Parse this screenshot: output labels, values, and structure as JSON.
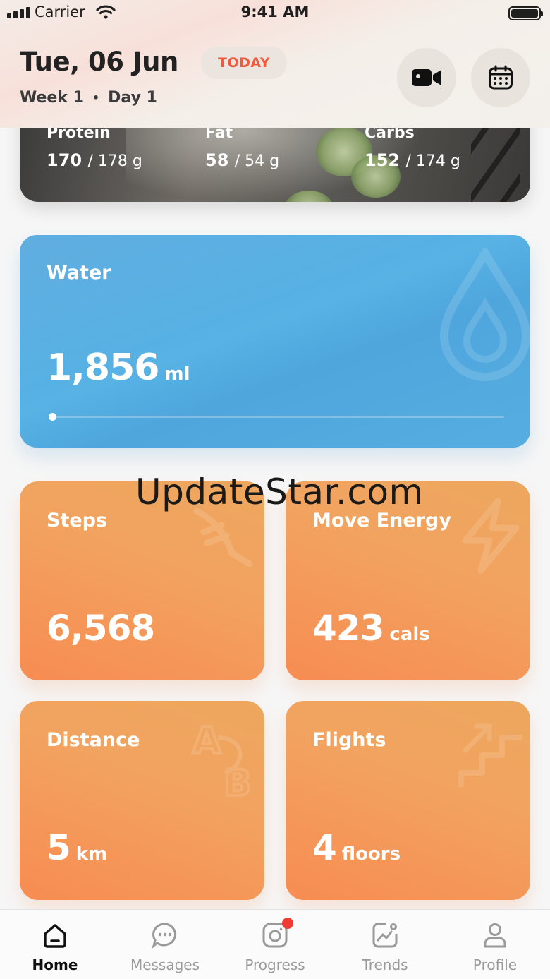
{
  "status_bar": {
    "carrier": "Carrier",
    "time": "9:41 AM"
  },
  "header": {
    "date": "Tue, 06 Jun",
    "today_badge": "TODAY",
    "week": "Week 1",
    "separator": "•",
    "day": "Day 1",
    "video_icon": "video-camera-icon",
    "calendar_icon": "calendar-icon"
  },
  "macros": [
    {
      "label": "Protein",
      "value": "170",
      "target": "/ 178 g"
    },
    {
      "label": "Fat",
      "value": "58",
      "target": "/ 54 g"
    },
    {
      "label": "Carbs",
      "value": "152",
      "target": "/ 174 g"
    }
  ],
  "water": {
    "title": "Water",
    "value": "1,856",
    "unit": "ml",
    "progress": 0.0,
    "icon": "water-drop-icon"
  },
  "tiles": {
    "steps": {
      "title": "Steps",
      "value": "6,568",
      "unit": "",
      "icon": "shoe-icon"
    },
    "move_energy": {
      "title": "Move Energy",
      "value": "423",
      "unit": "cals",
      "icon": "lightning-icon"
    },
    "distance": {
      "title": "Distance",
      "value": "5",
      "unit": "km",
      "icon": "a-to-b-icon"
    },
    "flights": {
      "title": "Flights",
      "value": "4",
      "unit": "floors",
      "icon": "stairs-icon"
    }
  },
  "watermark": "UpdateStar.com",
  "tabbar": {
    "items": [
      {
        "label": "Home",
        "icon": "home-icon",
        "active": true
      },
      {
        "label": "Messages",
        "icon": "messages-icon",
        "active": false
      },
      {
        "label": "Progress",
        "icon": "camera-icon",
        "active": false,
        "badge": true
      },
      {
        "label": "Trends",
        "icon": "trends-icon",
        "active": false
      },
      {
        "label": "Profile",
        "icon": "profile-icon",
        "active": false
      }
    ]
  },
  "colors": {
    "accent_badge": "#ef5a3c",
    "water_blue": "#4fa5dd",
    "tile_orange": "#f2a35f",
    "notification_red": "#ef3b34"
  }
}
